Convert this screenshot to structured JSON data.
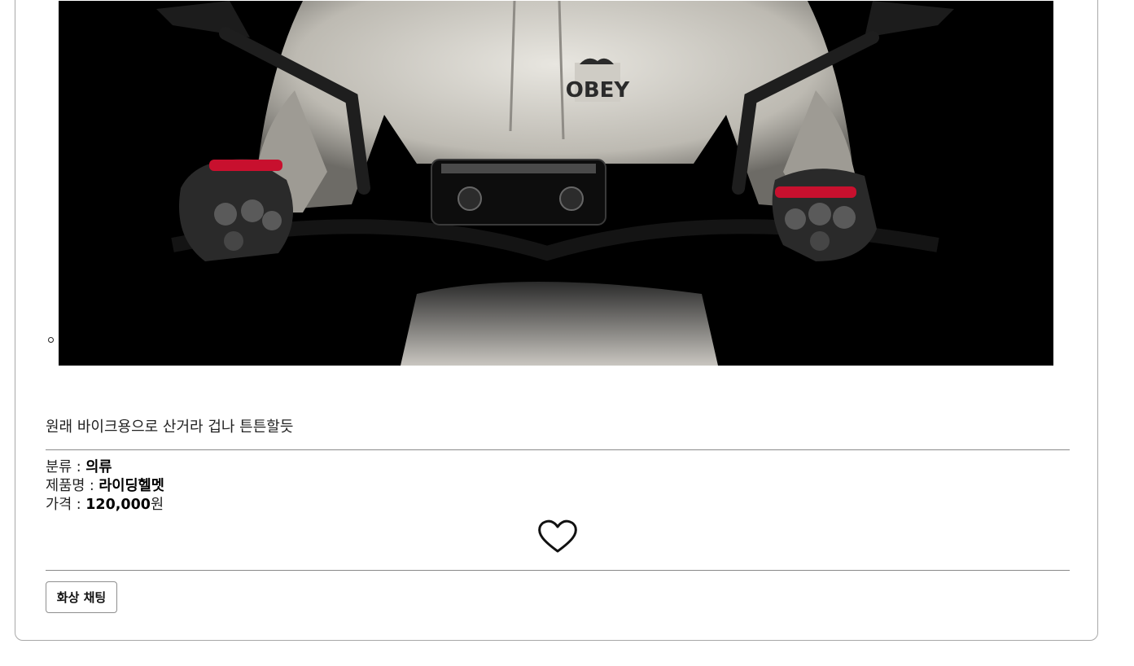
{
  "post": {
    "description": "원래 바이크용으로 산거라 겁나 튼튼할듯",
    "image": {
      "subject": "motorcycle rider in white hoodie with riding gloves gripping handlebars",
      "hoodie_logo": "OBEY"
    }
  },
  "details": {
    "category_label": "분류 : ",
    "category_value": "의류",
    "name_label": "제품명 : ",
    "name_value": "라이딩헬멧",
    "price_label": "가격 : ",
    "price_value": "120,000",
    "price_unit": "원"
  },
  "actions": {
    "like_icon": "heart-outline-icon",
    "chat_label": "화상 채팅"
  },
  "colors": {
    "card_border": "#a8a8a8",
    "divider": "#8a8a8a",
    "glove_accent": "#c8102e"
  }
}
